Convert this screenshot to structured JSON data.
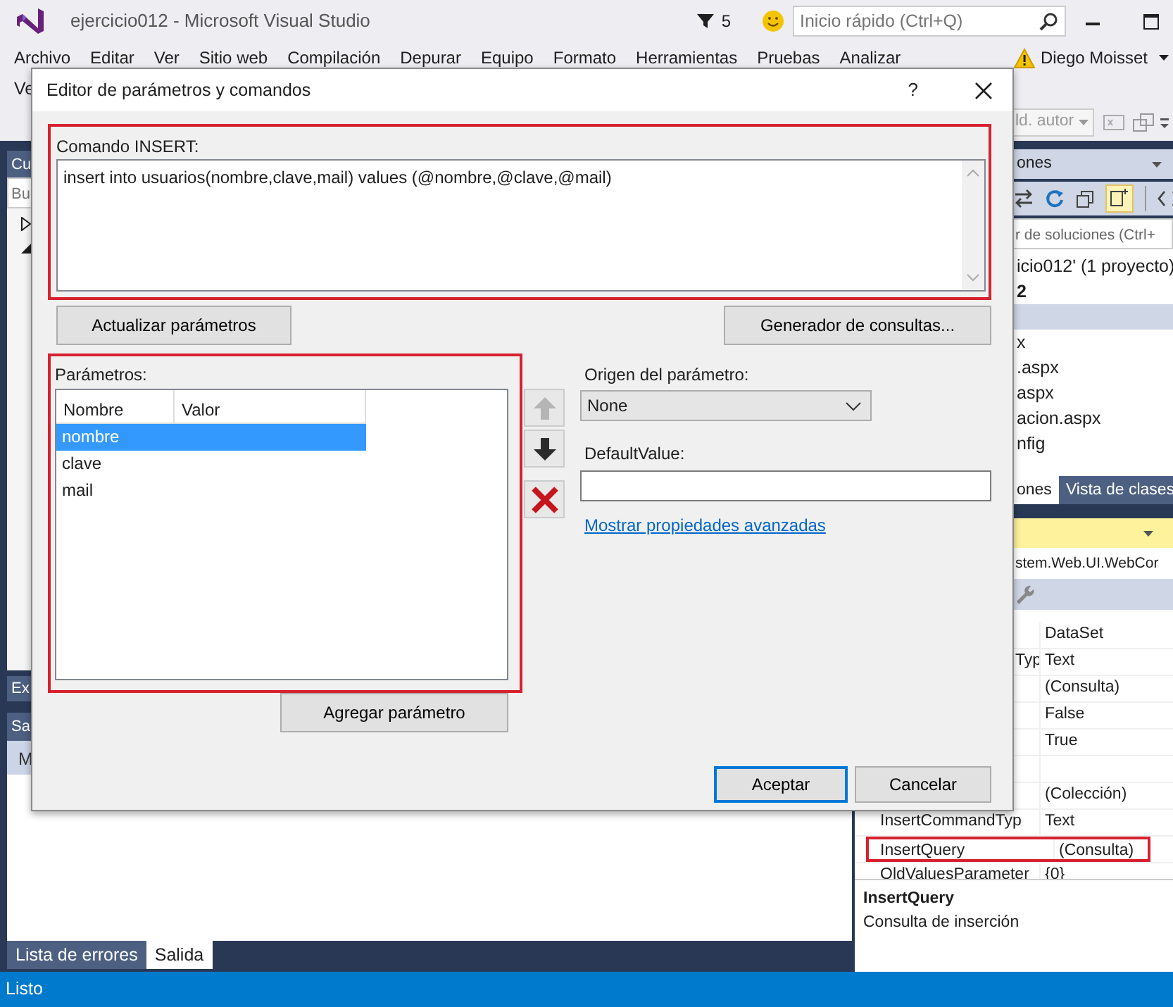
{
  "window": {
    "title": "ejercicio012 - Microsoft Visual Studio",
    "notifications": "5",
    "quick_launch": {
      "placeholder": "Inicio rápido (Ctrl+Q)"
    }
  },
  "menu": [
    "Archivo",
    "Editar",
    "Ver",
    "Sitio web",
    "Compilación",
    "Depurar",
    "Equipo",
    "Formato",
    "Herramientas",
    "Pruebas",
    "Analizar"
  ],
  "user": "Diego Moisset",
  "menu_overflow": "Ve",
  "toolbar": {
    "dropdown": "ld. autor"
  },
  "left_panel": {
    "title": "Cu",
    "search": "Bu",
    "toggles": [
      {
        "expanded": false
      },
      {
        "expanded": true
      }
    ],
    "tab": "Ex"
  },
  "output_panel": {
    "title": "Sa",
    "row": "M"
  },
  "bottom_tabs": [
    {
      "label": "Lista de errores",
      "selected": false
    },
    {
      "label": "Salida",
      "selected": true
    }
  ],
  "solution_explorer": {
    "title": "ones",
    "search": "r de soluciones (Ctrl+",
    "items": [
      {
        "label": "icio012'  (1 proyecto)",
        "bold": false,
        "selected": false
      },
      {
        "label": "2",
        "bold": true,
        "selected": false
      },
      {
        "bold": false,
        "selected": true
      },
      {
        "label": "x",
        "bold": false,
        "selected": false
      },
      {
        "label": ".aspx",
        "bold": false,
        "selected": false
      },
      {
        "label": "aspx",
        "bold": false,
        "selected": false
      },
      {
        "label": "acion.aspx",
        "bold": false,
        "selected": false
      },
      {
        "label": "nfig",
        "bold": false,
        "selected": false
      }
    ]
  },
  "panel_tabs": [
    {
      "label": "ones",
      "selected": true
    },
    {
      "label": "Vista de clases",
      "selected": false
    }
  ],
  "properties": {
    "object": "stem.Web.UI.WebCor",
    "rows": [
      {
        "value": "DataSet",
        "highlighted": false
      },
      {
        "name": "Typ",
        "name_cut": true,
        "value": "Text",
        "highlighted": false
      },
      {
        "value": "(Consulta)",
        "highlighted": false
      },
      {
        "value": "False",
        "highlighted": false
      },
      {
        "value": "True",
        "highlighted": false
      },
      {
        "highlighted": false
      },
      {
        "value": "(Colección)",
        "highlighted": false
      },
      {
        "name": "InsertCommandTyp",
        "name_cut": false,
        "value": "Text",
        "highlighted": false
      },
      {
        "name": "InsertQuery",
        "name_cut": false,
        "value": "(Consulta)",
        "highlighted": true
      },
      {
        "name": "OldValuesParameter",
        "name_cut": false,
        "value": "{0}",
        "highlighted": false
      }
    ],
    "description": {
      "title": "InsertQuery",
      "text": "Consulta de inserción"
    }
  },
  "status_bar": "Listo",
  "dialog": {
    "title": "Editor de parámetros y comandos",
    "help": "?",
    "command": {
      "label": "Comando INSERT:",
      "text": "insert into usuarios(nombre,clave,mail) values (@nombre,@clave,@mail)",
      "highlighted": true
    },
    "refresh_button": "Actualizar parámetros",
    "query_builder_button": "Generador de consultas...",
    "parameters": {
      "label": "Parámetros:",
      "highlighted": true,
      "columns": [
        "Nombre",
        "Valor"
      ],
      "items": [
        {
          "name": "nombre",
          "selected": true
        },
        {
          "name": "clave",
          "selected": false
        },
        {
          "name": "mail",
          "selected": false
        }
      ]
    },
    "move_buttons": [
      {
        "kind": "up",
        "disabled": true
      },
      {
        "kind": "down",
        "disabled": false
      },
      {
        "kind": "delete",
        "disabled": false
      }
    ],
    "source": {
      "label": "Origen del parámetro:",
      "value": "None"
    },
    "default_value": {
      "label": "DefaultValue:"
    },
    "advanced_link": "Mostrar propiedades avanzadas",
    "add_button": "Agregar parámetro",
    "buttons": [
      {
        "label": "Aceptar",
        "default": true
      },
      {
        "label": "Cancelar",
        "default": false
      }
    ]
  }
}
